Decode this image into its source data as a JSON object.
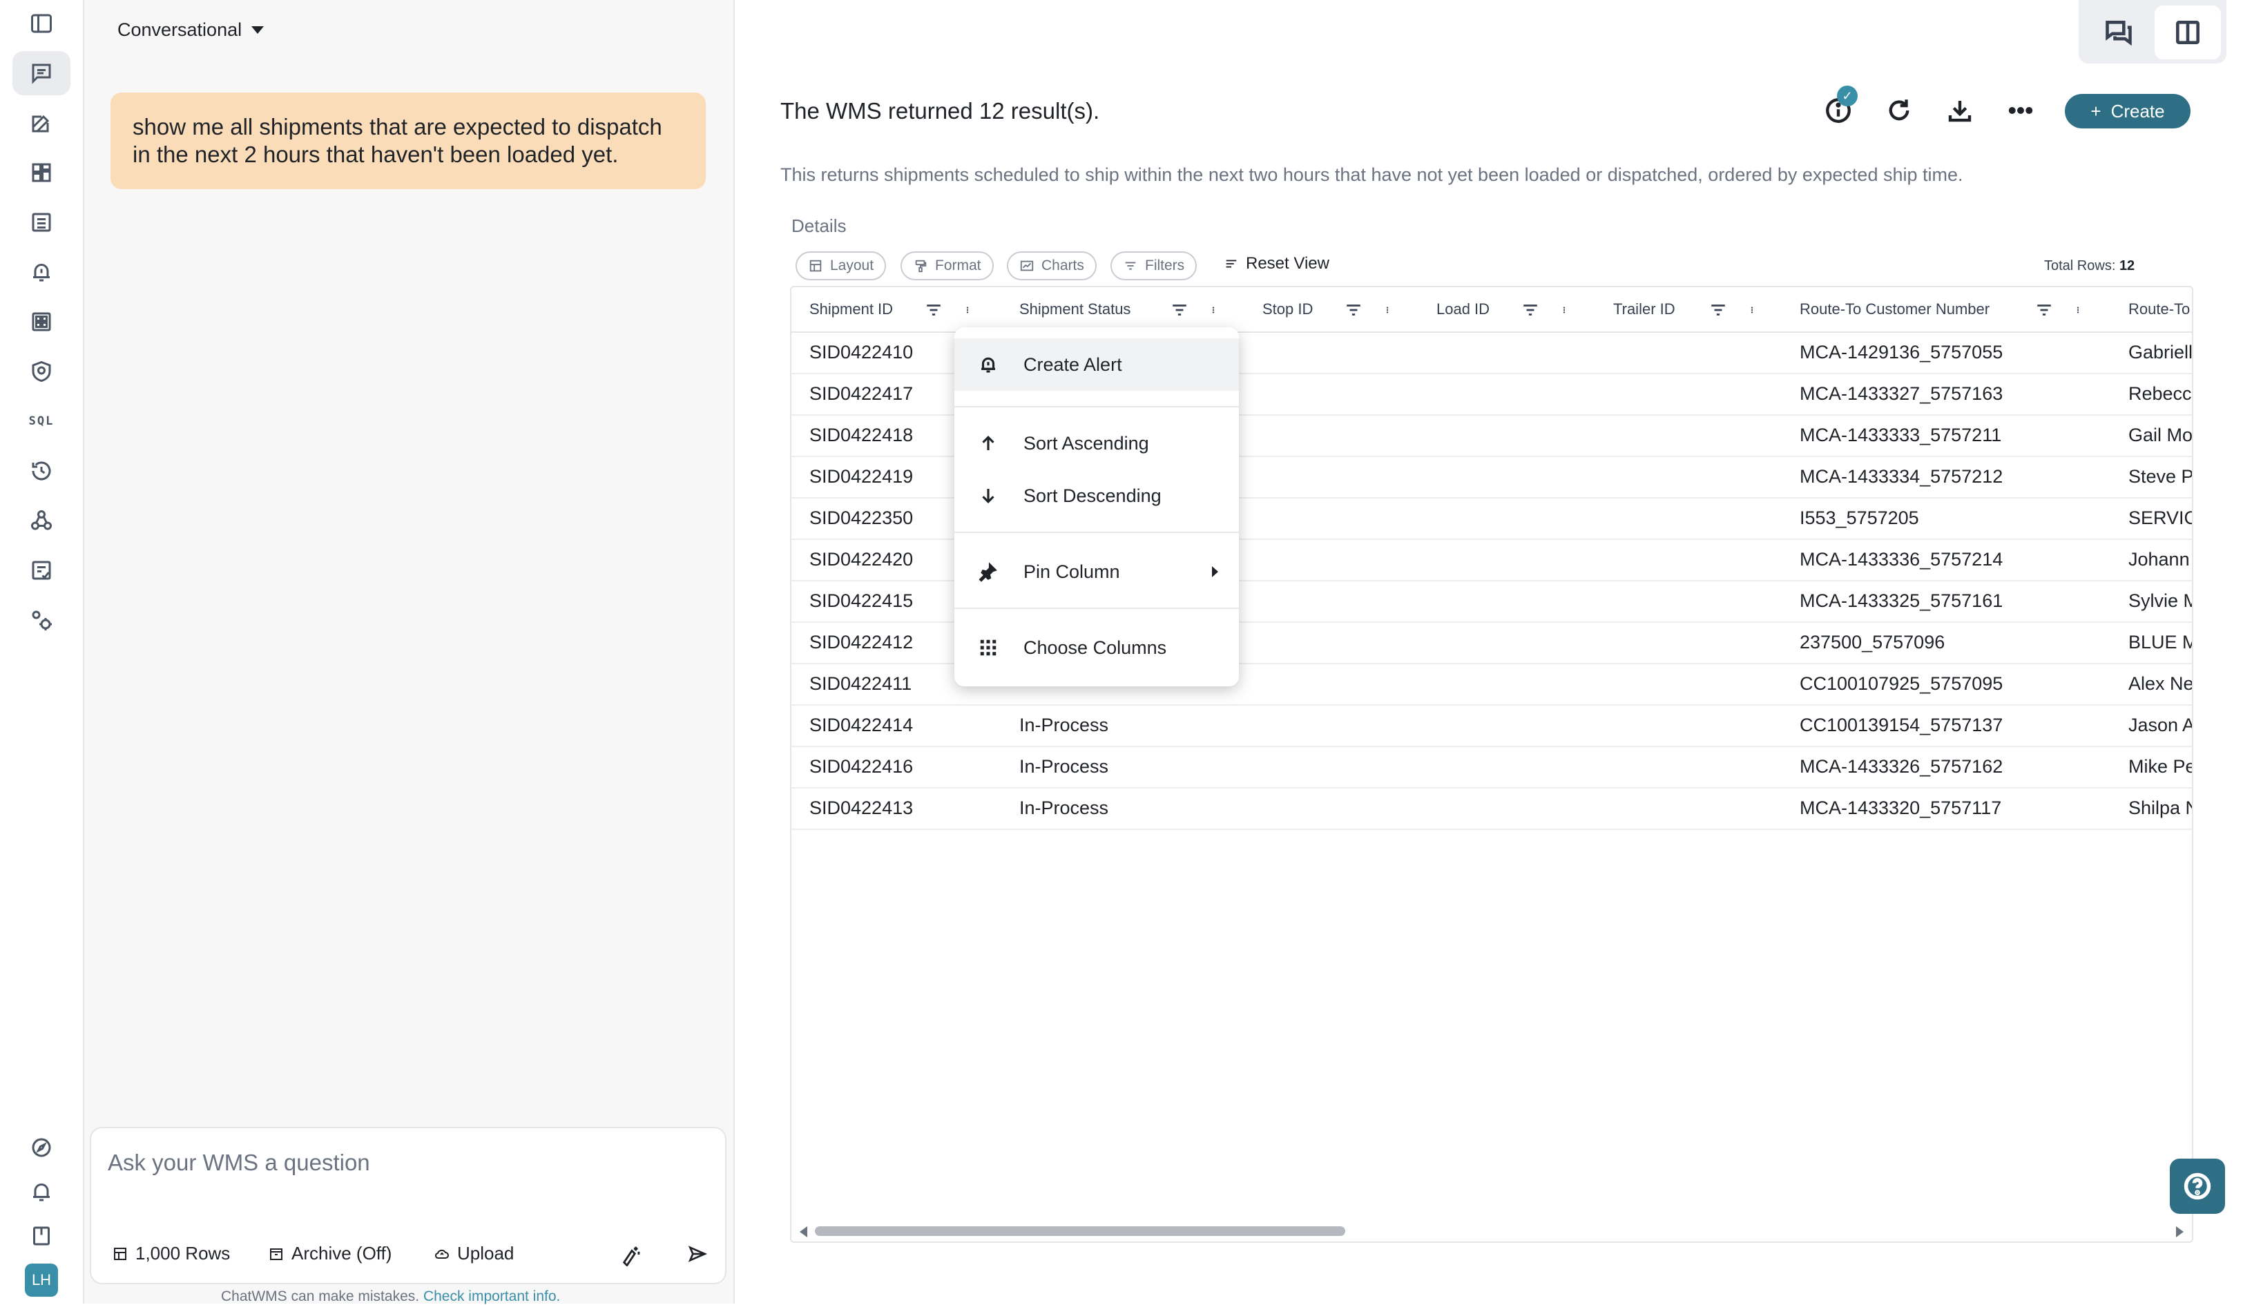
{
  "app": {
    "mode_label": "Conversational",
    "avatar_initials": "LH"
  },
  "chat": {
    "user_message": "show me all shipments that are expected to dispatch in the next 2 hours that haven't been loaded yet.",
    "input_placeholder": "Ask your WMS a question",
    "rows_label": "1,000 Rows",
    "archive_label": "Archive (Off)",
    "upload_label": "Upload",
    "disclaimer": "ChatWMS can make mistakes.",
    "disclaimer_link": "Check important info."
  },
  "rail": {
    "sql_label": "SQL"
  },
  "result": {
    "title": "The WMS returned 12 result(s).",
    "description": "This returns shipments scheduled to ship within the next two hours that have not yet been loaded or dispatched, ordered by expected ship time.",
    "create_label": "Create",
    "details_label": "Details",
    "info_badge": "✓"
  },
  "toolbar": {
    "layout": "Layout",
    "format": "Format",
    "charts": "Charts",
    "filters": "Filters",
    "reset_view": "Reset View",
    "total_rows_label": "Total Rows:",
    "total_rows_value": "12"
  },
  "table": {
    "columns": [
      "Shipment ID",
      "Shipment Status",
      "Stop ID",
      "Load ID",
      "Trailer ID",
      "Route-To Customer Number",
      "Route-To"
    ],
    "rows": [
      {
        "id": "SID0422410",
        "status": "",
        "cust": "MCA-1429136_5757055",
        "name": "Gabriell"
      },
      {
        "id": "SID0422417",
        "status": "",
        "cust": "MCA-1433327_5757163",
        "name": "Rebecca"
      },
      {
        "id": "SID0422418",
        "status": "",
        "cust": "MCA-1433333_5757211",
        "name": "Gail Mo"
      },
      {
        "id": "SID0422419",
        "status": "",
        "cust": "MCA-1433334_5757212",
        "name": "Steve P"
      },
      {
        "id": "SID0422350",
        "status": "",
        "cust": "I553_5757205",
        "name": "SERVIC"
      },
      {
        "id": "SID0422420",
        "status": "",
        "cust": "MCA-1433336_5757214",
        "name": "Johann"
      },
      {
        "id": "SID0422415",
        "status": "",
        "cust": "MCA-1433325_5757161",
        "name": "Sylvie M"
      },
      {
        "id": "SID0422412",
        "status": "",
        "cust": "237500_5757096",
        "name": "BLUE M"
      },
      {
        "id": "SID0422411",
        "status": "",
        "cust": "CC100107925_5757095",
        "name": "Alex Ne"
      },
      {
        "id": "SID0422414",
        "status": "In-Process",
        "cust": "CC100139154_5757137",
        "name": "Jason A"
      },
      {
        "id": "SID0422416",
        "status": "In-Process",
        "cust": "MCA-1433326_5757162",
        "name": "Mike Pe"
      },
      {
        "id": "SID0422413",
        "status": "In-Process",
        "cust": "MCA-1433320_5757117",
        "name": "Shilpa N"
      }
    ]
  },
  "context_menu": {
    "create_alert": "Create Alert",
    "sort_ascending": "Sort Ascending",
    "sort_descending": "Sort Descending",
    "pin_column": "Pin Column",
    "choose_columns": "Choose Columns"
  }
}
